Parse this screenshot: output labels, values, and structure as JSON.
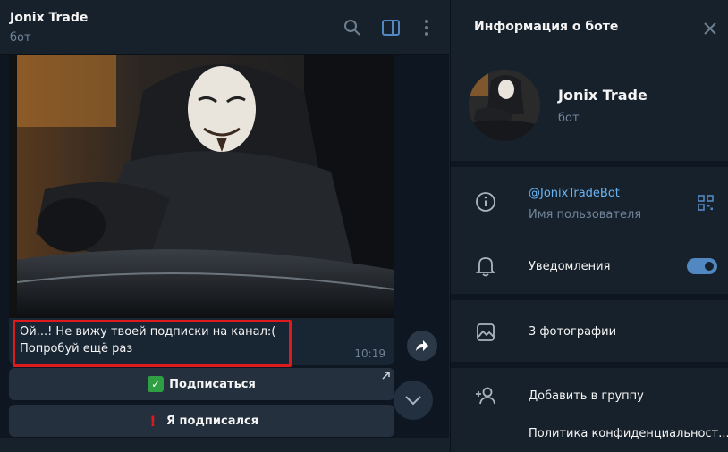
{
  "chat": {
    "title": "Jonix Trade",
    "status": "бот",
    "message": {
      "text": "Ой...! Не вижу твоей подписки на канал:(\nПопробуй ещё раз",
      "time": "10:19"
    },
    "buttons": [
      {
        "emoji": "✅",
        "label": "Подписаться"
      },
      {
        "emoji": "❗",
        "label": "Я подписался"
      }
    ]
  },
  "info": {
    "title": "Информация о боте",
    "name": "Jonix Trade",
    "subtitle": "бот",
    "username": "@JonixTradeBot",
    "username_label": "Имя пользователя",
    "notifications_label": "Уведомления",
    "notifications_on": true,
    "photos_label": "3 фотографии",
    "add_to_group_label": "Добавить в группу",
    "policy_label": "Политика конфиденциальност..."
  },
  "colors": {
    "accent": "#5288c1",
    "link": "#6ab3f3",
    "highlight": "#e0191f",
    "bg_chat": "#0e1621",
    "bg_panel": "#17212b"
  },
  "icons": [
    "search-icon",
    "sidebar-toggle-icon",
    "more-vertical-icon",
    "close-icon",
    "info-icon",
    "qr-code-icon",
    "bell-icon",
    "image-icon",
    "add-user-icon",
    "share-icon",
    "chevron-down-icon"
  ]
}
